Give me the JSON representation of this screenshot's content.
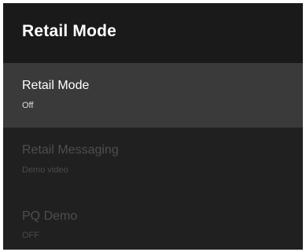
{
  "header": {
    "title": "Retail Mode"
  },
  "menu": {
    "items": [
      {
        "title": "Retail Mode",
        "value": "Off",
        "state": "selected"
      },
      {
        "title": "Retail Messaging",
        "value": "Demo video",
        "state": "disabled"
      },
      {
        "title": "PQ Demo",
        "value": "OFF",
        "state": "disabled"
      }
    ]
  },
  "colors": {
    "panel_background": "#202020",
    "header_background": "#1a1a1a",
    "selected_background": "#3a3a3a",
    "text_primary": "#ffffff",
    "text_disabled": "#4e4e4e"
  }
}
